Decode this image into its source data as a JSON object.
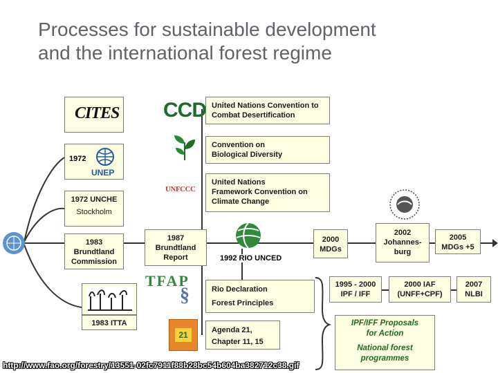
{
  "title_line1": "Processes for sustainable development",
  "title_line2": "and the international forest regime",
  "boxes": {
    "cites_logo": "CITES",
    "unep_year": "1972",
    "unep_logo": "UNEP",
    "unche_line1": "1972 UNCHE",
    "unche_line2": "Stockholm",
    "brundtland_line1": "1983",
    "brundtland_line2": "Brundtland",
    "brundtland_line3": "Commission",
    "itta": "1983 ITTA",
    "report_line1": "1987",
    "report_line2": "Brundtland",
    "report_line3": "Report",
    "unced": "1992 RIO UNCED",
    "ccd_logo": "CCD",
    "ccd_line1": "United Nations Convention to",
    "ccd_line2": "Combat Desertification",
    "cbd_line1": "Convention on",
    "cbd_line2": "Biological Diversity",
    "unfccc_logo": "UNFCCC",
    "unfccc_line1": "United Nations",
    "unfccc_line2": "Framework Convention on",
    "unfccc_line3": "Climate Change",
    "rio_line1": "Rio Declaration",
    "rio_line2": "Forest Principles",
    "tfap_logo": "TFAP",
    "agenda_line1": "Agenda 21,",
    "agenda_line2": "Chapter  11, 15",
    "agenda_logo": "21",
    "mdgs_line1": "2000",
    "mdgs_line2": "MDGs",
    "joburg_line1": "2002",
    "joburg_line2": "Johannes-",
    "joburg_line3": "burg",
    "mdg5_line1": "2005",
    "mdg5_line2": "MDGs +5",
    "ipf_line1": "1995 - 2000",
    "ipf_line2": "IPF / IFF",
    "iaf_line1": "2000 IAF",
    "iaf_line2": "(UNFF+CPF)",
    "nlbi_line1": "2007",
    "nlbi_line2": "NLBI",
    "proposals_line1": "IPF/IFF Proposals",
    "proposals_line2": "for Action",
    "nfp_line1": "National forest",
    "nfp_line2": "programmes"
  },
  "url": "http://www.fao.org/forestry/13551-02fc7911f88b28bc54b604ba382712c38.gif",
  "colors": {
    "box_fill": "#fdfde2",
    "line": "#333333",
    "title": "#5f6368",
    "ccd_green": "#1e6b2a",
    "unep_blue": "#1f5aa8",
    "tfap_green": "#2f8a3a",
    "un_blue": "#5b92d1"
  }
}
